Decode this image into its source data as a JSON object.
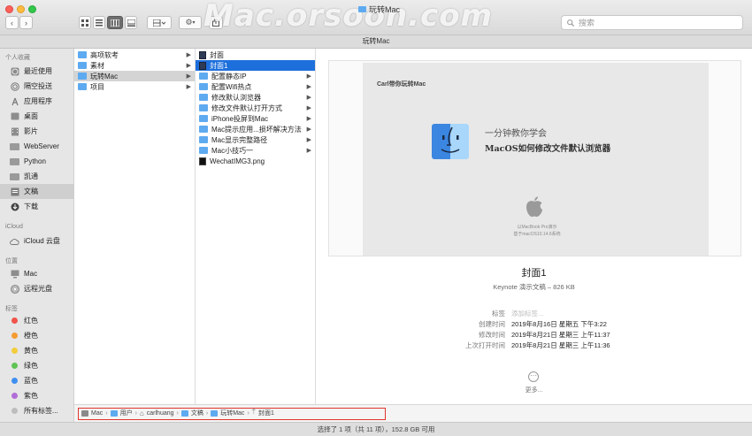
{
  "window": {
    "title": "玩转Mac",
    "watermark": "Mac.orsoon.com"
  },
  "toolbar": {
    "back_glyph": "‹",
    "forward_glyph": "›",
    "search_placeholder": "搜索"
  },
  "path_title": "玩转Mac",
  "sidebar": {
    "sections": [
      {
        "label": "个人收藏"
      },
      {
        "label": "iCloud"
      },
      {
        "label": "位置"
      },
      {
        "label": "标签"
      }
    ],
    "favorites": [
      {
        "label": "最近使用",
        "icon": "clock-icon"
      },
      {
        "label": "隔空投送",
        "icon": "airdrop-icon"
      },
      {
        "label": "应用程序",
        "icon": "apps-icon"
      },
      {
        "label": "桌面",
        "icon": "desktop-icon"
      },
      {
        "label": "影片",
        "icon": "movie-icon"
      },
      {
        "label": "WebServer",
        "icon": "folder-icon"
      },
      {
        "label": "Python",
        "icon": "folder-icon"
      },
      {
        "label": "凯通",
        "icon": "folder-icon"
      },
      {
        "label": "文稿",
        "icon": "document-icon"
      },
      {
        "label": "下载",
        "icon": "download-icon"
      }
    ],
    "icloud": [
      {
        "label": "iCloud 云盘",
        "icon": "cloud-icon"
      }
    ],
    "locations": [
      {
        "label": "Mac",
        "icon": "computer-icon"
      },
      {
        "label": "远程光盘",
        "icon": "disc-icon"
      }
    ],
    "tags": [
      {
        "label": "红色",
        "color": "#f0544b"
      },
      {
        "label": "橙色",
        "color": "#f59b33"
      },
      {
        "label": "黄色",
        "color": "#f3cd3b"
      },
      {
        "label": "绿色",
        "color": "#5fc454"
      },
      {
        "label": "蓝色",
        "color": "#3f8ff0"
      },
      {
        "label": "紫色",
        "color": "#b16ed8"
      },
      {
        "label": "所有标签...",
        "color": "#bdbdbd"
      }
    ]
  },
  "column1": [
    {
      "label": "高项软考"
    },
    {
      "label": "素材"
    },
    {
      "label": "玩转Mac"
    },
    {
      "label": "项目"
    }
  ],
  "column2": [
    {
      "label": "封面",
      "kind": "keynote"
    },
    {
      "label": "封面1",
      "kind": "keynote"
    },
    {
      "label": "配置静态IP",
      "kind": "folder"
    },
    {
      "label": "配置Wifi热点",
      "kind": "folder"
    },
    {
      "label": "修改默认浏览器",
      "kind": "folder"
    },
    {
      "label": "修改文件默认打开方式",
      "kind": "folder"
    },
    {
      "label": "iPhone投屏到Mac",
      "kind": "folder"
    },
    {
      "label": "Mac提示应用...损坏解决方法",
      "kind": "folder"
    },
    {
      "label": "Mac显示完整路径",
      "kind": "folder"
    },
    {
      "label": "Mac小技巧一",
      "kind": "folder"
    },
    {
      "label": "WechatIMG3.png",
      "kind": "image"
    }
  ],
  "preview": {
    "slide": {
      "brand": "Carl带你玩转Mac",
      "heading": "一分钟教你学会",
      "subheading": "MacOS如何修改文件默认浏览器",
      "caption1": "以MacBook Pro演示",
      "caption2": "基于macOS10.14.6系统"
    },
    "name": "封面1",
    "kind": "Keynote 演示文稿 – 826 KB",
    "meta": [
      {
        "key": "标签",
        "value": "添加标签...",
        "placeholder": true
      },
      {
        "key": "创建时间",
        "value": "2019年8月16日 星期五 下午3:22"
      },
      {
        "key": "修改时间",
        "value": "2019年8月21日 星期三 上午11:37"
      },
      {
        "key": "上次打开时间",
        "value": "2019年8月21日 星期三 上午11:36"
      }
    ],
    "more_label": "更多..."
  },
  "pathbar": [
    {
      "label": "Mac",
      "icon": "computer-icon"
    },
    {
      "label": "用户",
      "icon": "folder-icon"
    },
    {
      "label": "carlhuang",
      "icon": "home-icon"
    },
    {
      "label": "文稿",
      "icon": "folder-icon"
    },
    {
      "label": "玩转Mac",
      "icon": "folder-icon"
    },
    {
      "label": "封面1",
      "icon": "keynote-icon"
    }
  ],
  "status": "选择了 1 项（共 11 项），152.8 GB 可用"
}
